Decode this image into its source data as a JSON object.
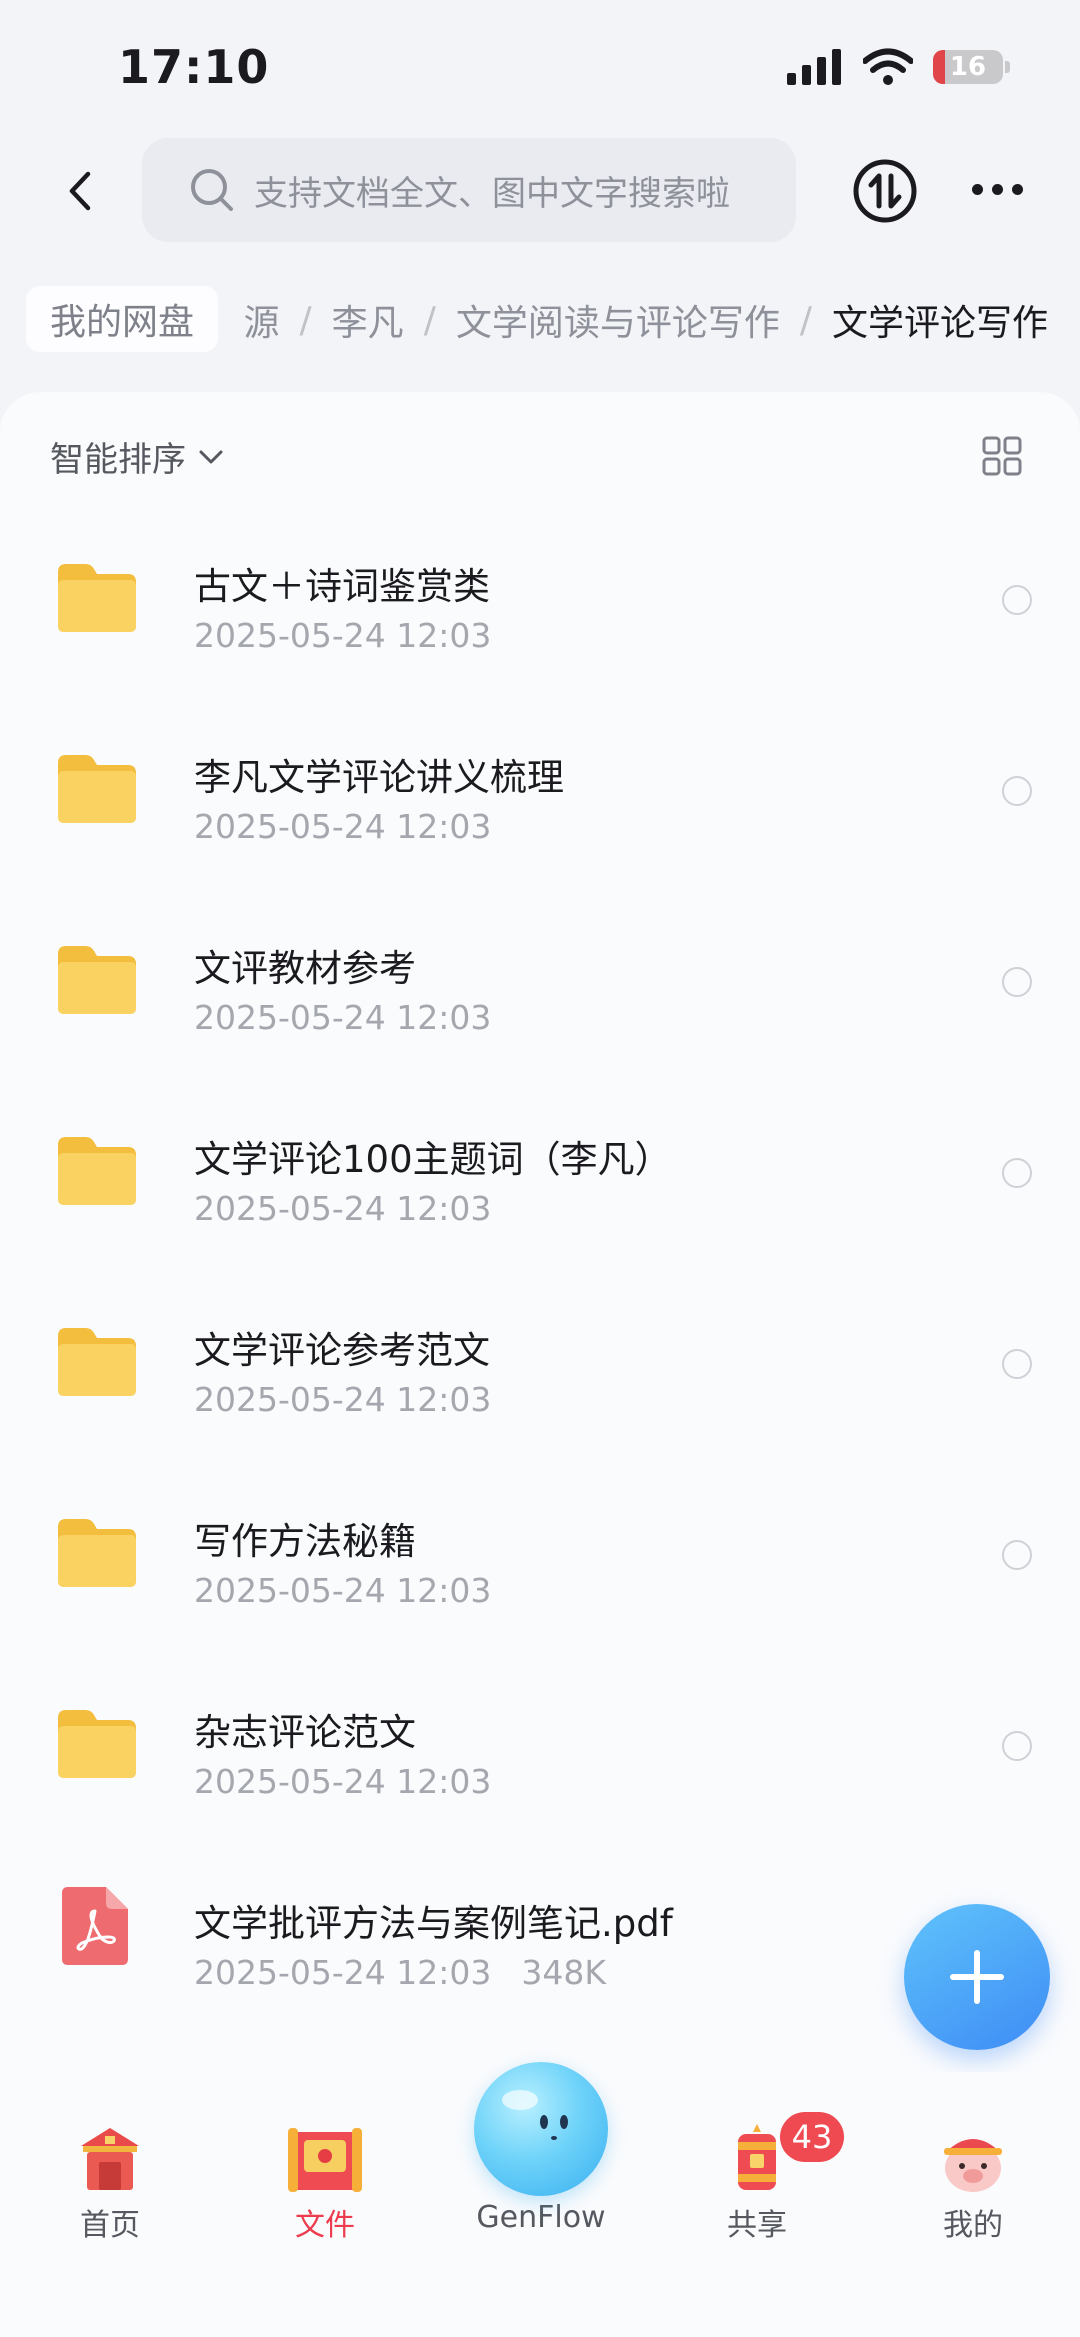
{
  "status": {
    "time": "17:10",
    "battery": "16"
  },
  "search": {
    "placeholder": "支持文档全文、图中文字搜索啦"
  },
  "breadcrumb": {
    "home": "我的网盘",
    "partial": "源",
    "items": [
      "李凡",
      "文学阅读与评论写作"
    ],
    "current": "文学评论写作",
    "separator": "/"
  },
  "sort": {
    "label": "智能排序"
  },
  "files": [
    {
      "name": "古文＋诗词鉴赏类",
      "date": "2025-05-24 12:03",
      "type": "folder"
    },
    {
      "name": "李凡文学评论讲义梳理",
      "date": "2025-05-24 12:03",
      "type": "folder"
    },
    {
      "name": "文评教材参考",
      "date": "2025-05-24 12:03",
      "type": "folder"
    },
    {
      "name": "文学评论100主题词（李凡）",
      "date": "2025-05-24 12:03",
      "type": "folder"
    },
    {
      "name": "文学评论参考范文",
      "date": "2025-05-24 12:03",
      "type": "folder"
    },
    {
      "name": "写作方法秘籍",
      "date": "2025-05-24 12:03",
      "type": "folder"
    },
    {
      "name": "杂志评论范文",
      "date": "2025-05-24 12:03",
      "type": "folder"
    },
    {
      "name": "文学批评方法与案例笔记.pdf",
      "date": "2025-05-24 12:03",
      "size": "348K",
      "type": "pdf"
    }
  ],
  "tabs": [
    {
      "label": "首页"
    },
    {
      "label": "文件",
      "active": true
    },
    {
      "label": "GenFlow"
    },
    {
      "label": "共享",
      "badge": "43"
    },
    {
      "label": "我的"
    }
  ],
  "colors": {
    "accent": "#ee3c4f",
    "fab": "#4a9af7",
    "folder": "#f8cc52"
  }
}
